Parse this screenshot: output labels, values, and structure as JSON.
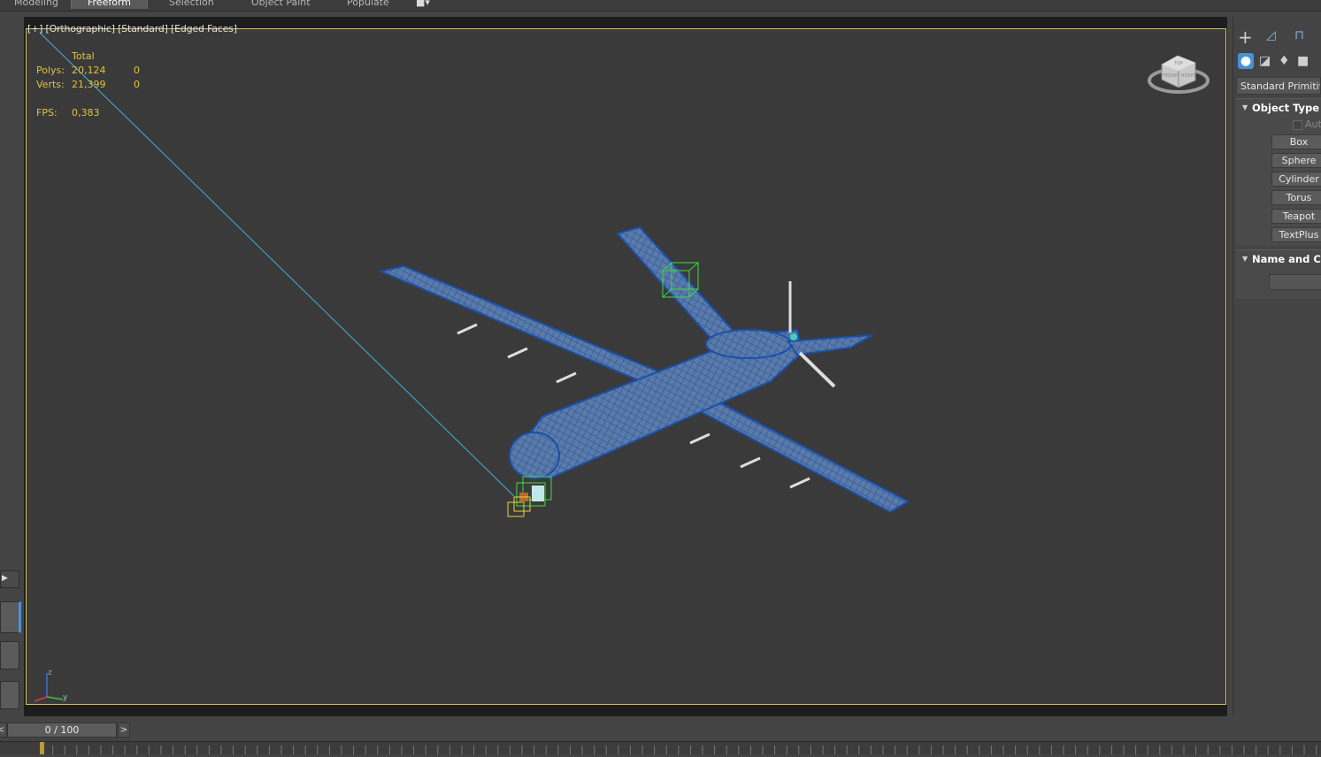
{
  "ribbon": {
    "tabs": [
      {
        "label": "Modeling"
      },
      {
        "label": "Freeform"
      },
      {
        "label": "Selection"
      },
      {
        "label": "Object Paint"
      },
      {
        "label": "Populate"
      }
    ],
    "active_tab": "Freeform"
  },
  "viewport": {
    "label_plus": "[+]",
    "label_view": "[Orthographic]",
    "label_shading": "[Standard]",
    "label_edges": "[Edged Faces]",
    "stats": {
      "header": "Total",
      "polys_label": "Polys:",
      "polys_total": "20,124",
      "polys_selected": "0",
      "verts_label": "Verts:",
      "verts_total": "21,399",
      "verts_selected": "0",
      "fps_label": "FPS:",
      "fps_value": "0,383"
    },
    "axis": {
      "z": "z",
      "y": "y"
    },
    "viewcube_labels": {
      "top": "TOP",
      "front": "FRONT",
      "right": "RIGHT"
    }
  },
  "command_panel": {
    "category_dropdown": "Standard Primitives",
    "object_type_title": "Object Type",
    "autogrid_label": "AutoGrid",
    "buttons": [
      "Box",
      "Sphere",
      "Cylinder",
      "Torus",
      "Teapot",
      "TextPlus"
    ],
    "name_color_title": "Name and Color"
  },
  "timeline": {
    "frame_display": "0 / 100",
    "prev_label": "<",
    "next_label": ">"
  },
  "colors": {
    "viewport_bg": "#3a3a3a",
    "active_border": "#d6c15a",
    "stats_text": "#e2c23d",
    "wire_blue": "#1c4fa8",
    "mesh_fill": "#5b7aa6"
  }
}
